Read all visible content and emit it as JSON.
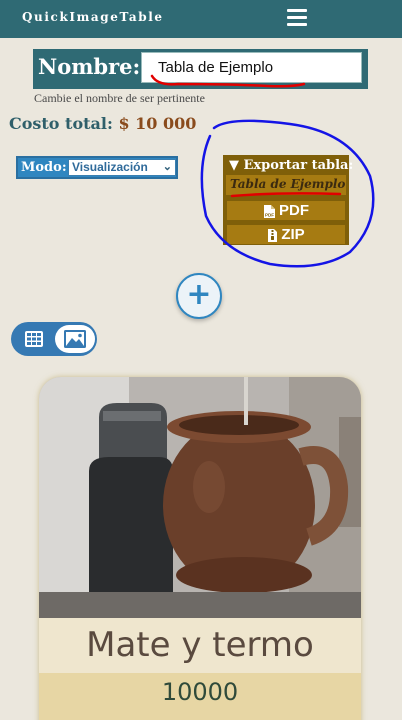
{
  "app": {
    "title": "QuickImageTable"
  },
  "name_section": {
    "label": "Nombre:",
    "value": "Tabla de Ejemplo",
    "hint": "Cambie el nombre de ser pertinente"
  },
  "cost": {
    "label": "Costo total:",
    "value": "$ 10 000"
  },
  "mode": {
    "label": "Modo:",
    "selected": "Visualización"
  },
  "export": {
    "title": "▼ Exportar tabla:",
    "table_name": "Tabla de Ejemplo",
    "pdf_label": "PDF",
    "zip_label": "ZIP"
  },
  "add_button": {
    "label": "+"
  },
  "view_toggle": {
    "active": "image-view"
  },
  "items": [
    {
      "title": "Mate y termo",
      "price": "10000"
    }
  ],
  "colors": {
    "header": "#2f6a74",
    "background": "#ebe7dd",
    "accent_blue": "#2f86c0",
    "export_brown": "#7f5f09",
    "price_strip": "#e7d6a4",
    "annotation_red": "#e10000",
    "annotation_blue": "#1414e6"
  }
}
